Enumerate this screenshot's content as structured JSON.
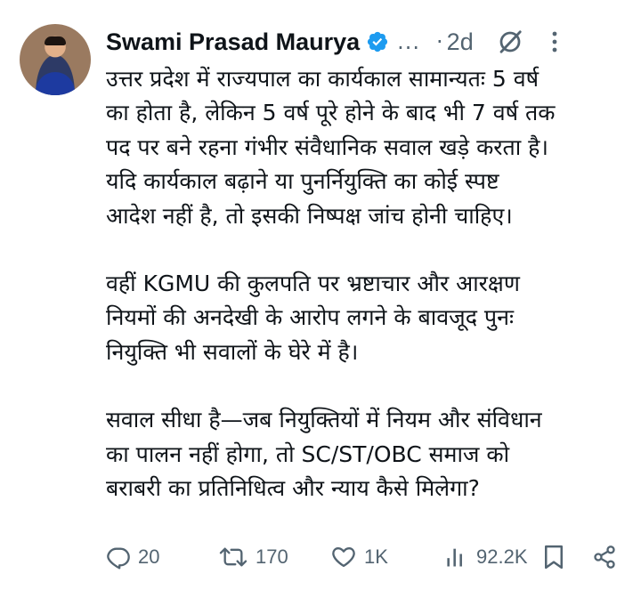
{
  "tweet": {
    "author_name": "Swami Prasad Maurya",
    "handle_truncated": "...",
    "separator": "·",
    "age": "2d",
    "paragraphs": [
      {
        "lines": [
          "उत्तर प्रदेश में राज्यपाल का कार्यकाल सामान्यतः 5 वर्ष",
          "का होता है, लेकिन 5 वर्ष पूरे होने के बाद भी 7 वर्ष तक",
          "पद पर बने रहना गंभीर संवैधानिक सवाल खड़े करता है।",
          "यदि कार्यकाल बढ़ाने या पुनर्नियुक्ति का कोई स्पष्ट",
          "आदेश नहीं है, तो इसकी निष्पक्ष जांच होनी चाहिए।"
        ]
      },
      {
        "lines": [
          "वहीं KGMU की कुलपति पर भ्रष्टाचार और आरक्षण",
          "नियमों की अनदेखी के आरोप लगने के बावजूद पुनः",
          "नियुक्ति भी सवालों के घेरे में है।"
        ]
      },
      {
        "lines": [
          "सवाल सीधा है—जब नियुक्तियों में नियम और संविधान",
          "का पालन नहीं होगा, तो SC/ST/OBC समाज को",
          "बराबरी का प्रतिनिधित्व और न्याय कैसे मिलेगा?"
        ]
      }
    ]
  },
  "actions": {
    "replies": "20",
    "reposts": "170",
    "likes": "1K",
    "views": "92.2K"
  },
  "icons": {
    "verified": "verified-badge-icon",
    "grok": "grok-icon",
    "more": "more-vertical-icon",
    "reply": "reply-icon",
    "repost": "repost-icon",
    "like": "heart-icon",
    "views": "analytics-icon",
    "bookmark": "bookmark-icon",
    "share": "share-icon"
  },
  "colors": {
    "text": "#0f1419",
    "secondary": "#536471",
    "verified": "#1d9bf0"
  }
}
